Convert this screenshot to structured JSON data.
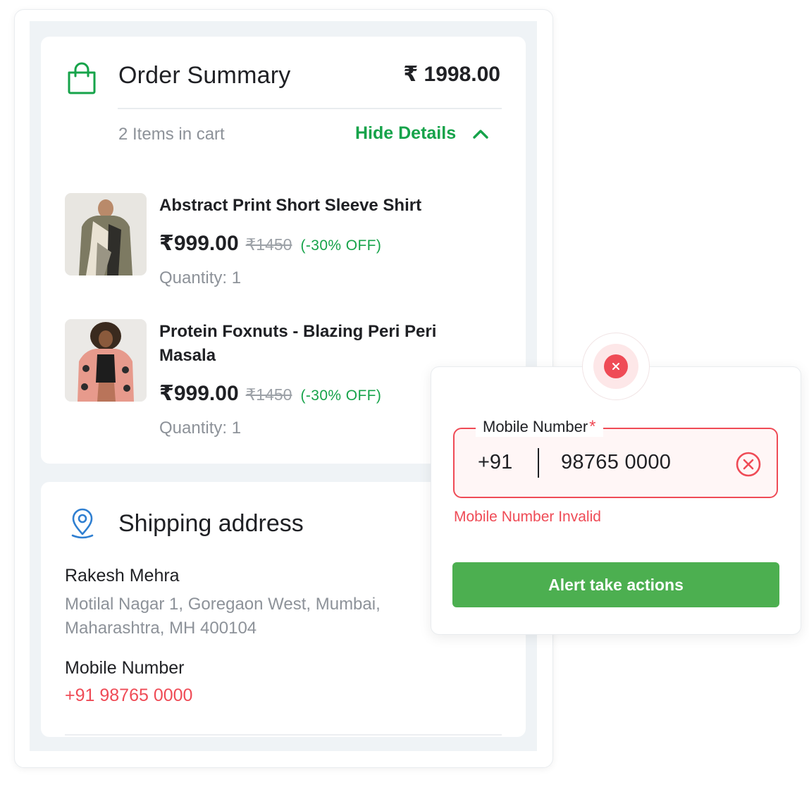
{
  "order_summary": {
    "title": "Order Summary",
    "total": "₹ 1998.00",
    "items_count": "2 Items in cart",
    "toggle_label": "Hide Details",
    "items": [
      {
        "name_line1": "Abstract Print Short Sleeve Shirt",
        "name_line2": "",
        "price": "₹999.00",
        "old_price": "₹1450",
        "discount": "(-30% OFF)",
        "quantity": "Quantity: 1"
      },
      {
        "name_line1": "Protein Foxnuts - Blazing Peri Peri",
        "name_line2": "Masala",
        "price": "₹999.00",
        "old_price": "₹1450",
        "discount": "(-30% OFF)",
        "quantity": "Quantity: 1"
      }
    ]
  },
  "shipping": {
    "title": "Shipping address",
    "name": "Rakesh Mehra",
    "address": "Motilal Nagar 1, Goregaon West, Mumbai, Maharashtra, MH 400104",
    "mobile_label": "Mobile Number",
    "mobile_value": "+91 98765 0000"
  },
  "alert": {
    "field_label": "Mobile Number",
    "required_mark": "*",
    "country_code": "+91",
    "value": "98765 0000",
    "error": "Mobile Number Invalid",
    "action_label": "Alert take actions"
  },
  "colors": {
    "accent_green": "#16a34a",
    "error_red": "#ef4b56",
    "button_green": "#4caf50",
    "panel_gray": "#eff3f6"
  },
  "icons": [
    "shopping-bag-icon",
    "chevron-up-icon",
    "location-pin-icon",
    "error-x-icon",
    "clear-circle-icon"
  ]
}
